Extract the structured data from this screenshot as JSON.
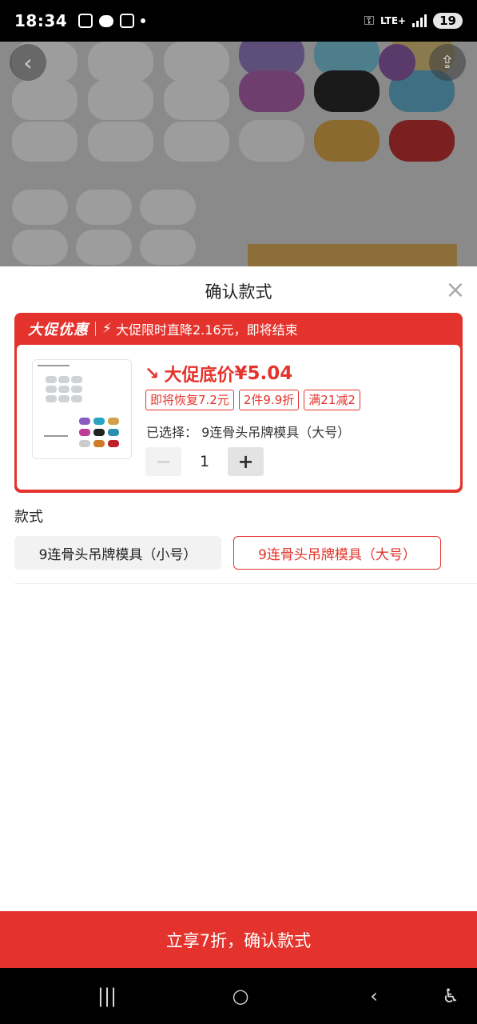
{
  "status_bar": {
    "time": "18:34",
    "network": "LTE+",
    "battery": "19"
  },
  "sheet": {
    "title": "确认款式",
    "promo": {
      "brand": "大促优惠",
      "message": "大促限时直降2.16元，即将结束",
      "price_label": "大促底价",
      "price_value": "¥5.04",
      "coupons": [
        "即将恢复7.2元",
        "2件9.9折",
        "满21减2"
      ],
      "selected_prefix": "已选择：",
      "selected_value": "9连骨头吊牌模具（大号）",
      "quantity": "1"
    },
    "style_section": {
      "label": "款式",
      "options": [
        {
          "label": "9连骨头吊牌模具（小号）",
          "selected": false
        },
        {
          "label": "9连骨头吊牌模具（大号）",
          "selected": true
        }
      ]
    },
    "confirm_button": "立享7折，确认款式"
  },
  "colors": {
    "accent": "#e4332c",
    "overlay": "#8a8a8a"
  },
  "icons": {
    "back": "back-arrow-icon",
    "share": "share-icon",
    "close": "close-icon",
    "bolt": "lightning-icon",
    "price_down": "down-trend-arrow-icon"
  }
}
